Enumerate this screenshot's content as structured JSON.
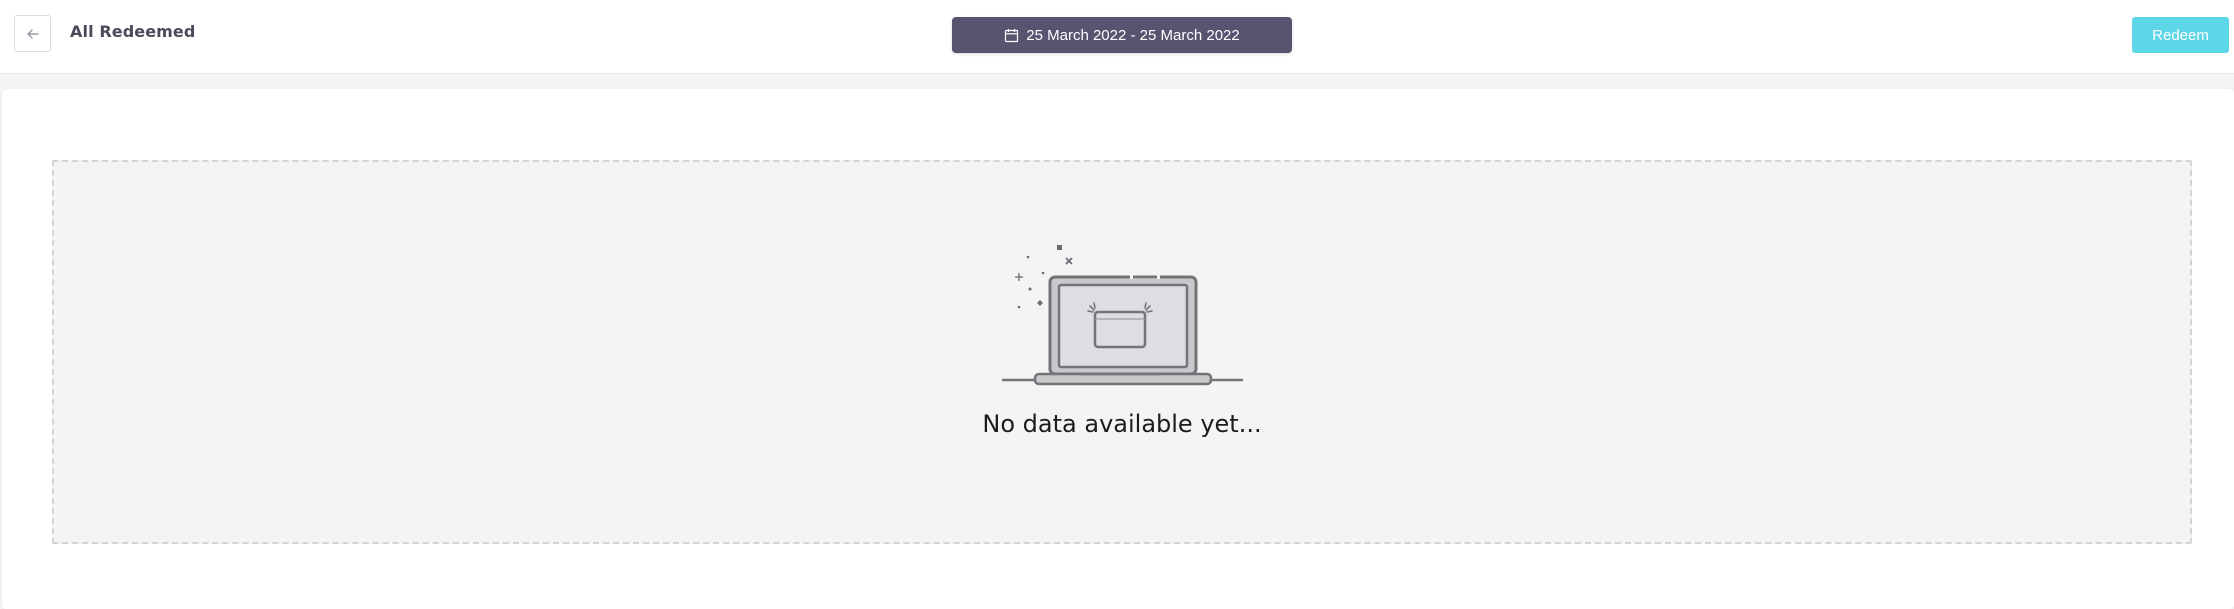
{
  "header": {
    "back_icon": "arrow-left-icon",
    "title": "All Redeemed",
    "date_range": "25 March 2022 - 25 March 2022",
    "calendar_icon": "calendar-icon",
    "redeem_label": "Redeem"
  },
  "main": {
    "empty_message": "No data available yet...",
    "illustration_icon": "empty-laptop-icon"
  },
  "colors": {
    "date_button_bg": "#575470",
    "redeem_button_bg": "#5dd6e8"
  }
}
